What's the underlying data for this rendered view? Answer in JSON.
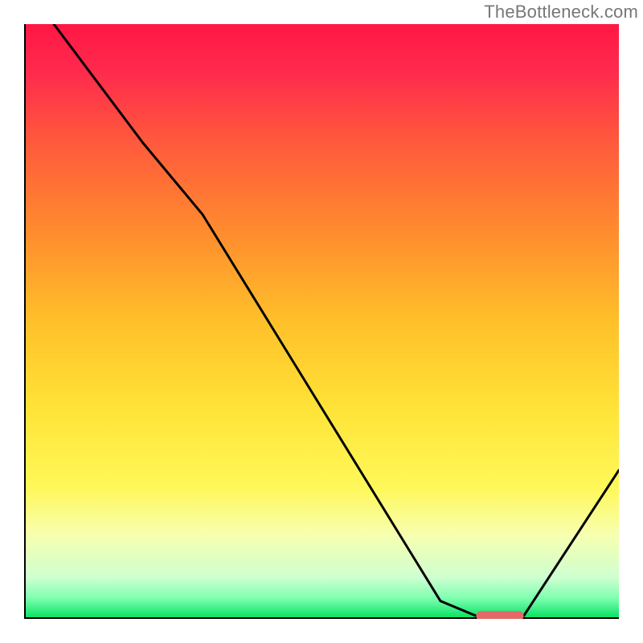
{
  "watermark": "TheBottleneck.com",
  "chart_data": {
    "type": "line",
    "title": "",
    "xlabel": "",
    "ylabel": "",
    "xlim": [
      0,
      100
    ],
    "ylim": [
      0,
      100
    ],
    "series": [
      {
        "name": "curve",
        "x": [
          5,
          20,
          30,
          70,
          76,
          84,
          100
        ],
        "y": [
          100,
          80,
          68,
          3,
          0.5,
          0.5,
          25
        ]
      }
    ],
    "marker": {
      "x_start": 76,
      "x_end": 84,
      "y": 0.5,
      "color": "#e46a6a"
    },
    "gradient_stops": [
      {
        "offset": 0.0,
        "color": "#ff1744"
      },
      {
        "offset": 0.08,
        "color": "#ff2a4d"
      },
      {
        "offset": 0.2,
        "color": "#ff5a3c"
      },
      {
        "offset": 0.35,
        "color": "#ff8c2e"
      },
      {
        "offset": 0.5,
        "color": "#ffc02a"
      },
      {
        "offset": 0.65,
        "color": "#ffe438"
      },
      {
        "offset": 0.78,
        "color": "#fff85a"
      },
      {
        "offset": 0.86,
        "color": "#f6ffb0"
      },
      {
        "offset": 0.93,
        "color": "#cfffd0"
      },
      {
        "offset": 0.965,
        "color": "#7fffb0"
      },
      {
        "offset": 1.0,
        "color": "#00e060"
      }
    ],
    "axis_color": "#000000",
    "line_color": "#000000"
  }
}
